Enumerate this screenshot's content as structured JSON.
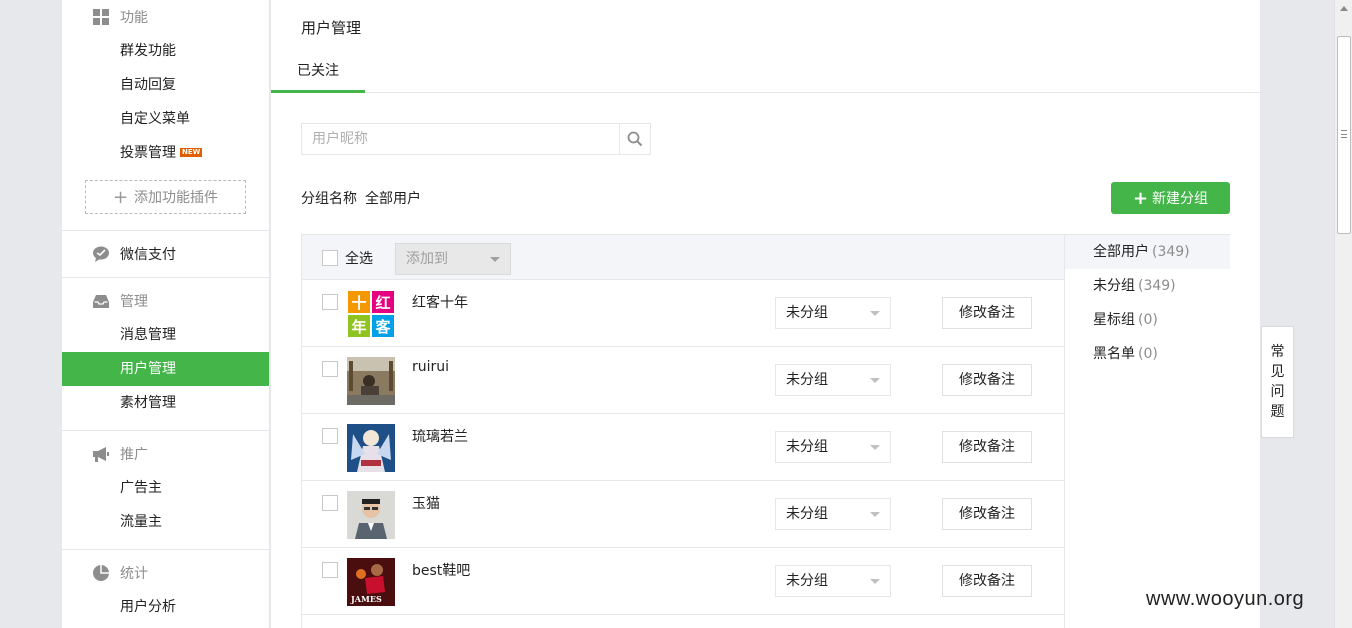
{
  "sidebar": {
    "sections": [
      {
        "title": "功能",
        "icon": "grid-icon",
        "items": [
          {
            "label": "群发功能"
          },
          {
            "label": "自动回复"
          },
          {
            "label": "自定义菜单"
          },
          {
            "label": "投票管理",
            "badge": "NEW"
          }
        ],
        "add_plugin": "添加功能插件"
      },
      {
        "title": "微信支付",
        "icon": "chat-bubble-icon",
        "items": []
      },
      {
        "title": "管理",
        "icon": "inbox-icon",
        "items": [
          {
            "label": "消息管理"
          },
          {
            "label": "用户管理"
          },
          {
            "label": "素材管理"
          }
        ]
      },
      {
        "title": "推广",
        "icon": "megaphone-icon",
        "items": [
          {
            "label": "广告主"
          },
          {
            "label": "流量主"
          }
        ]
      },
      {
        "title": "统计",
        "icon": "pie-chart-icon",
        "items": [
          {
            "label": "用户分析"
          }
        ]
      }
    ],
    "active_item": "用户管理"
  },
  "main": {
    "page_title": "用户管理",
    "tab": "已关注",
    "search_placeholder": "用户昵称",
    "group_label": "分组名称",
    "group_current": "全部用户",
    "new_group_button": "新建分组",
    "table": {
      "select_all": "全选",
      "add_to": "添加到",
      "rows": [
        {
          "name": "红客十年",
          "group": "未分组",
          "remark_button": "修改备注"
        },
        {
          "name": "ruirui",
          "group": "未分组",
          "remark_button": "修改备注"
        },
        {
          "name": "琉璃若兰",
          "group": "未分组",
          "remark_button": "修改备注"
        },
        {
          "name": "玉猫",
          "group": "未分组",
          "remark_button": "修改备注"
        },
        {
          "name": "best鞋吧",
          "group": "未分组",
          "remark_button": "修改备注"
        }
      ]
    },
    "groups": [
      {
        "name": "全部用户",
        "count": "(349)"
      },
      {
        "name": "未分组",
        "count": "(349)"
      },
      {
        "name": "星标组",
        "count": "(0)"
      },
      {
        "name": "黑名单",
        "count": "(0)"
      }
    ]
  },
  "faq": "常见问题",
  "avatar1_text": [
    "十",
    "红",
    "年",
    "客"
  ],
  "avatar5_text": "JAMES",
  "watermark": "www.wooyun.org",
  "colors": {
    "accent": "#44b549",
    "badge": "#e15f00"
  }
}
